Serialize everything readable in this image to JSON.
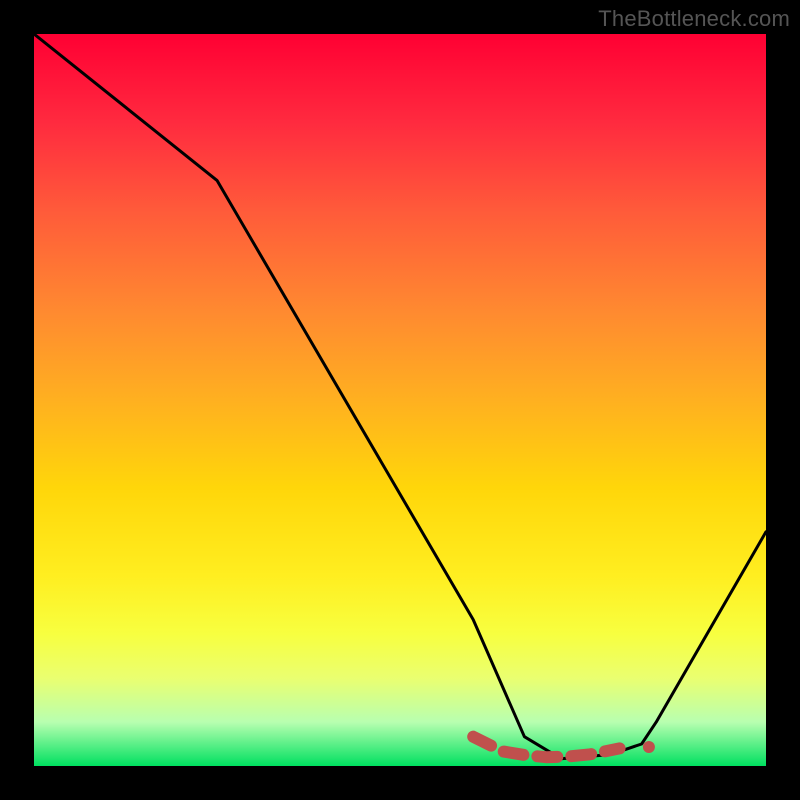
{
  "watermark": "TheBottleneck.com",
  "chart_data": {
    "type": "line",
    "title": "",
    "xlabel": "",
    "ylabel": "",
    "xlim": [
      0,
      100
    ],
    "ylim": [
      0,
      100
    ],
    "grid": false,
    "legend": false,
    "series": [
      {
        "name": "curve",
        "x": [
          0,
          10,
          25,
          60,
          67,
          72,
          78,
          80,
          83,
          85,
          100
        ],
        "y": [
          100,
          92,
          80,
          20,
          4,
          1,
          1.5,
          2,
          3,
          6,
          32
        ]
      }
    ],
    "annotations": [
      {
        "name": "highlight-dash",
        "type": "polyline",
        "color": "#c0504d",
        "width": 12,
        "dash": "round",
        "points_x": [
          60,
          64,
          67,
          70,
          73,
          76,
          78,
          80
        ],
        "points_y": [
          4,
          2,
          1.5,
          1.2,
          1.3,
          1.6,
          2.0,
          2.4
        ]
      },
      {
        "name": "highlight-dot",
        "type": "dot",
        "color": "#c0504d",
        "radius": 6,
        "x": 84,
        "y": 2.6
      }
    ]
  }
}
